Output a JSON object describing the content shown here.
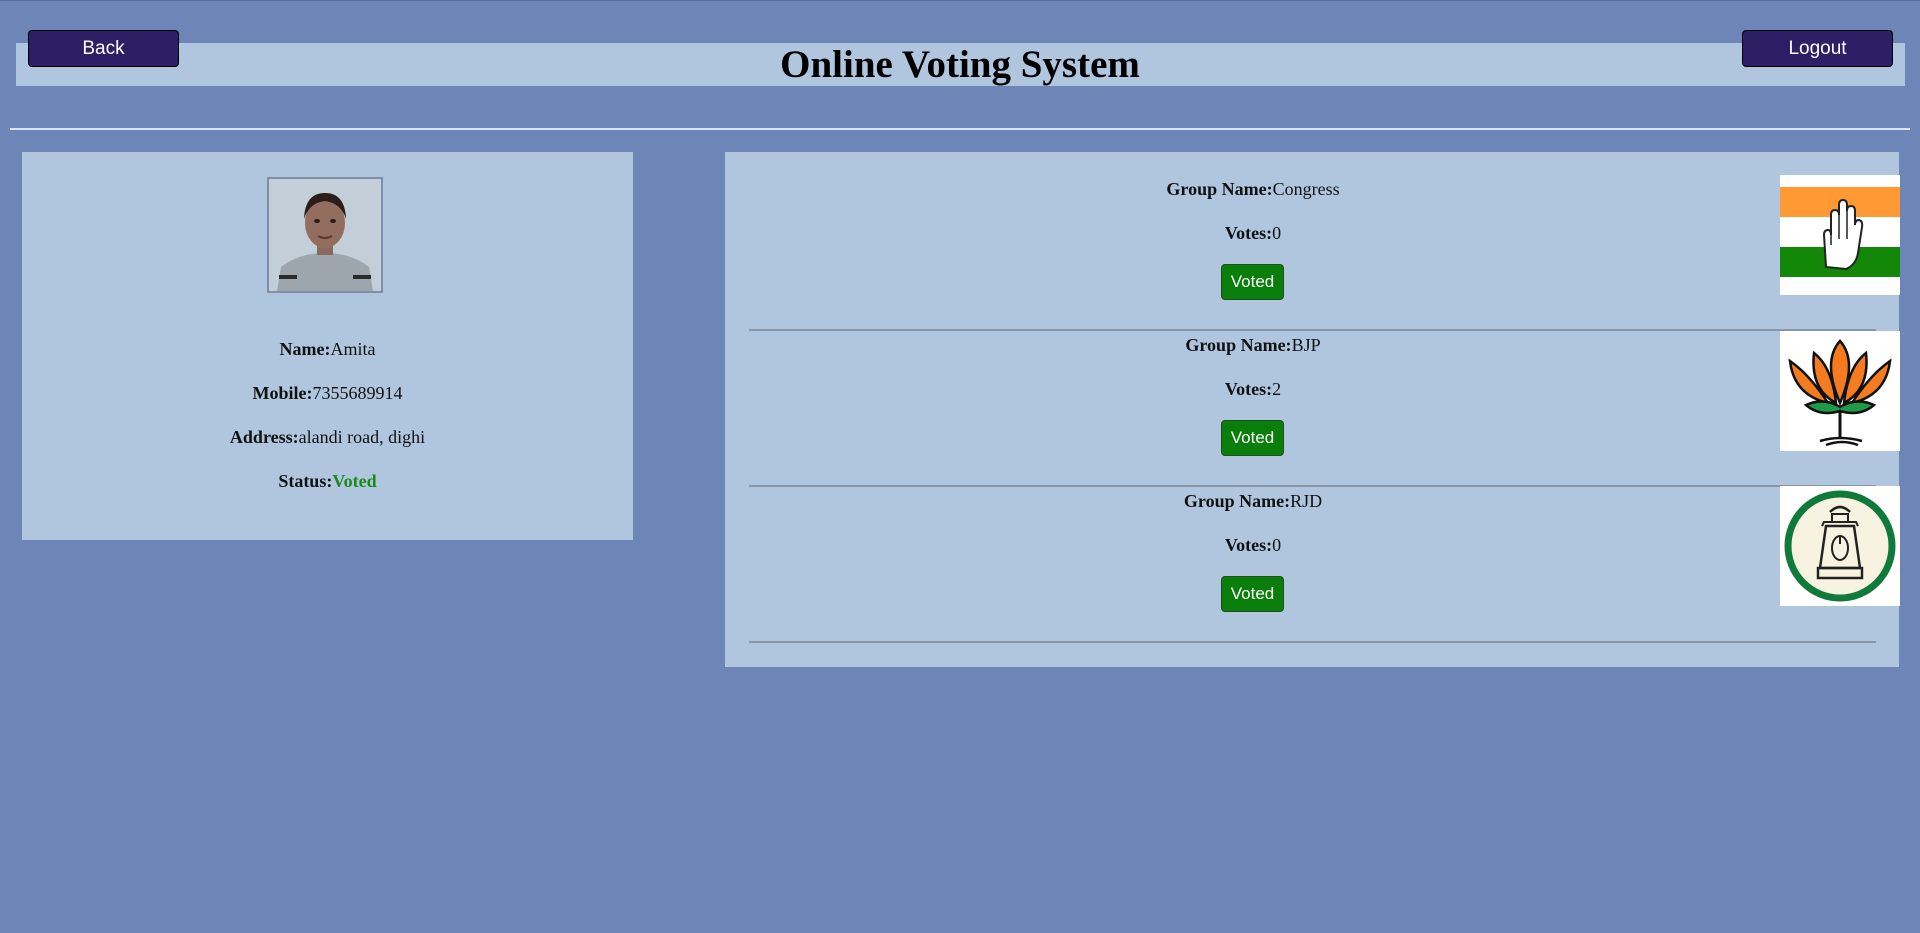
{
  "header": {
    "title": "Online Voting System",
    "back_label": "Back",
    "logout_label": "Logout"
  },
  "voter": {
    "photo_icon": "voter-photo",
    "name_label": "Name:",
    "name": "Amita",
    "mobile_label": "Mobile:",
    "mobile": "7355689914",
    "address_label": "Address:",
    "address": "alandi road, dighi",
    "status_label": "Status:",
    "status": "Voted"
  },
  "groups": [
    {
      "name_label": "Group Name:",
      "name": "Congress",
      "votes_label": "Votes:",
      "votes": "0",
      "button_label": "Voted",
      "symbol_icon": "congress-hand-symbol"
    },
    {
      "name_label": "Group Name:",
      "name": "BJP",
      "votes_label": "Votes:",
      "votes": "2",
      "button_label": "Voted",
      "symbol_icon": "bjp-lotus-symbol"
    },
    {
      "name_label": "Group Name:",
      "name": "RJD",
      "votes_label": "Votes:",
      "votes": "0",
      "button_label": "Voted",
      "symbol_icon": "rjd-lantern-symbol"
    }
  ],
  "colors": {
    "page_bg": "#6d85b7",
    "panel_bg": "#b0c6de",
    "nav_button": "#2c1f66",
    "vote_button": "#0a7e0a",
    "status_voted": "#1a8a1a"
  }
}
